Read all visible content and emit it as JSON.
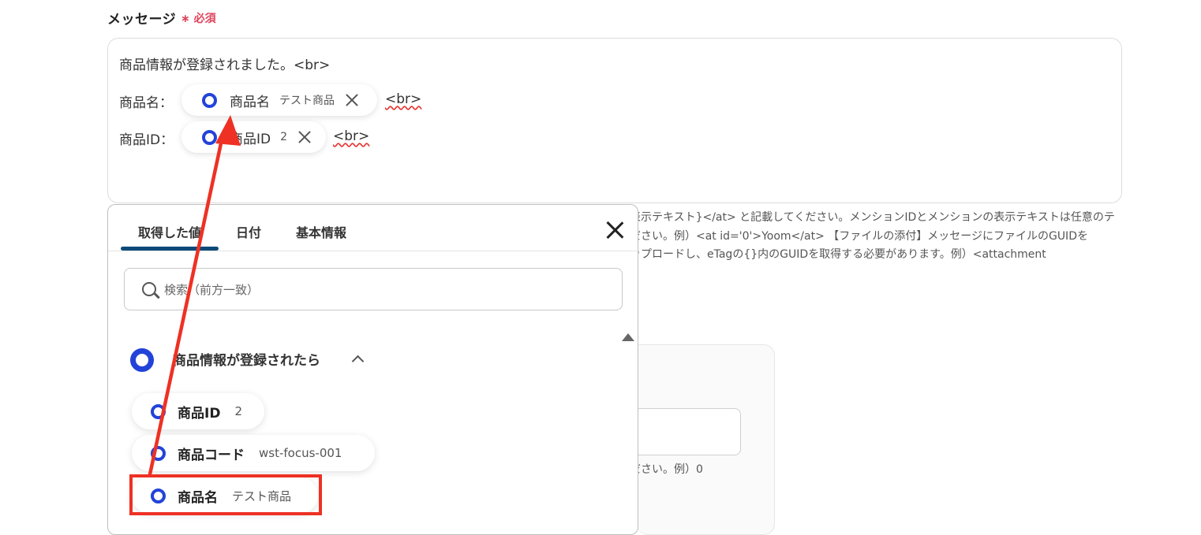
{
  "field": {
    "label": "メッセージ",
    "required": "∗ 必須"
  },
  "message": {
    "line1": "商品情報が登録されました。<br>",
    "line2_label": "商品名：",
    "line2_chip_name": "商品名",
    "line2_chip_value": "テスト商品",
    "line2_br": "<br>",
    "line3_label": "商品ID：",
    "line3_chip_name": "商品ID",
    "line3_chip_value": "2",
    "line3_br": "<br>"
  },
  "help": {
    "line1": "表示テキスト}</at> と記載してください。メンションIDとメンションの表示テキストは任意のテ",
    "line2": "ださい。例）<at id='0'>Yoom</at> 【ファイルの添付】メッセージにファイルのGUIDを",
    "line3": "ップロードし、eTagの{}内のGUIDを取得する必要があります。例）<attachment",
    "line4": "ださい。例）0"
  },
  "panel": {
    "tabs": [
      "取得した値",
      "日付",
      "基本情報"
    ],
    "active_tab": "取得した値",
    "search_placeholder": "検索（前方一致）",
    "group_title": "商品情報が登録されたら",
    "items": [
      {
        "name": "商品ID",
        "value": "2"
      },
      {
        "name": "商品コード",
        "value": "wst-focus-001"
      },
      {
        "name": "商品名",
        "value": "テスト商品"
      }
    ]
  },
  "colors": {
    "accent_blue": "#2243d9",
    "tab_underline": "#0d4a79",
    "annotation_red": "#ee3124",
    "required_red": "#e0445c"
  }
}
